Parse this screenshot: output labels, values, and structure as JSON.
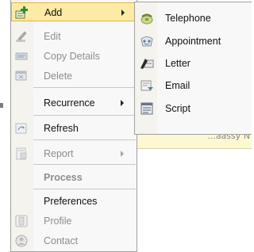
{
  "menu": {
    "items": [
      {
        "label": "Add",
        "icon": "add-record-icon",
        "enabled": true,
        "highlighted": true,
        "submenu": true
      },
      {
        "label": "Edit",
        "icon": "edit-pencil-icon",
        "enabled": false
      },
      {
        "label": "Copy Details",
        "icon": "copy-details-icon",
        "enabled": false
      },
      {
        "label": "Delete",
        "icon": "delete-icon",
        "enabled": false
      },
      {
        "label": "Recurrence",
        "enabled": true,
        "submenu": true
      },
      {
        "label": "Refresh",
        "icon": "refresh-icon",
        "enabled": true
      },
      {
        "label": "Report",
        "icon": "report-icon",
        "enabled": false,
        "submenu": true
      },
      {
        "label": "Process",
        "enabled": false,
        "bold": true
      },
      {
        "label": "Preferences",
        "enabled": true
      },
      {
        "label": "Profile",
        "icon": "profile-icon",
        "enabled": false
      },
      {
        "label": "Contact",
        "icon": "contact-icon",
        "enabled": false
      }
    ]
  },
  "submenu": {
    "items": [
      {
        "label": "Telephone",
        "icon": "telephone-icon"
      },
      {
        "label": "Appointment",
        "icon": "appointment-icon"
      },
      {
        "label": "Letter",
        "icon": "letter-icon"
      },
      {
        "label": "Email",
        "icon": "email-icon"
      },
      {
        "label": "Script",
        "icon": "script-icon"
      }
    ]
  },
  "background": {
    "field_text": "...aassy N"
  },
  "colors": {
    "highlight": "#fdeaa4",
    "highlight_border": "#e0b73f",
    "disabled_text": "#8d8d8d",
    "gutter": "#f4f3ee"
  }
}
